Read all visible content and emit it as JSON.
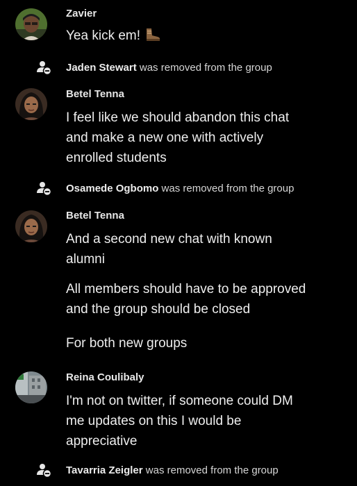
{
  "messages": {
    "m1": {
      "sender": "Zavier",
      "text": "Yea kick em!",
      "emoji_icon": "boot-icon"
    },
    "m2": {
      "sender": "Betel  Tenna",
      "lines": [
        "I feel like we should abandon this chat",
        "and make a new one with actively",
        "enrolled students"
      ]
    },
    "m3": {
      "sender": "Betel  Tenna",
      "lines": [
        "And a second new chat with known",
        "alumni"
      ],
      "follow_up_1": [
        "All members should have to be approved",
        "and the group should be closed"
      ],
      "follow_up_2": "For both new groups"
    },
    "m4": {
      "sender": "Reina Coulibaly",
      "lines": [
        "I'm not on twitter, if someone could DM",
        "me updates on this I would be",
        "appreciative"
      ]
    }
  },
  "system": {
    "s1": {
      "name": "Jaden Stewart",
      "action": " was removed from the group",
      "icon": "member-removed-icon"
    },
    "s2": {
      "name": "Osamede Ogbomo",
      "action": " was removed from the group",
      "icon": "member-removed-icon"
    },
    "s3": {
      "name": "Tavarria Zeigler",
      "action": " was removed from the group",
      "icon": "member-removed-icon"
    }
  },
  "colors": {
    "background": "#000000",
    "text": "#eeeeee",
    "system_text": "#d6d6d6"
  }
}
